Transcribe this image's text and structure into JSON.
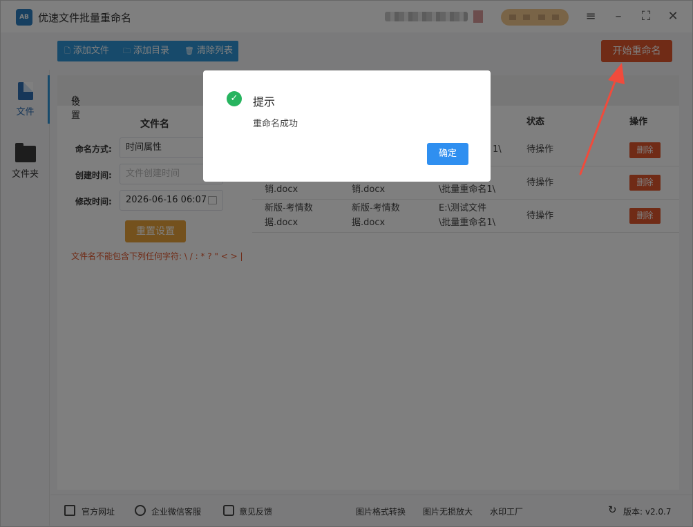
{
  "window": {
    "title": "优速文件批量重命名",
    "logo_text": "AB"
  },
  "toolbar": {
    "add_file": "添加文件",
    "add_dir": "添加目录",
    "clear_list": "清除列表",
    "start": "开始重命名"
  },
  "sidebar": {
    "items": [
      {
        "label": "文件",
        "icon": "file-icon"
      },
      {
        "label": "文件夹",
        "icon": "folder-icon"
      }
    ]
  },
  "settings": {
    "header": "设置",
    "section_title": "文件名",
    "naming_mode_label": "命名方式:",
    "naming_mode_value": "时间属性",
    "created_label": "创建时间:",
    "created_placeholder": "文件创建时间",
    "modified_label": "修改时间:",
    "modified_value": "2026-06-16 06:07",
    "reset_button": "重置设置",
    "warning": "文件名不能包含下列任何字符: \\ / : * ? \" < > |"
  },
  "table": {
    "headers": {
      "status": "状态",
      "action": "操作"
    },
    "rows": [
      {
        "col1": "",
        "col2": "",
        "col3": "1\\",
        "status": "待操作",
        "action": "删除"
      },
      {
        "col1": "销.docx",
        "col2": "销.docx",
        "col3": "\\批量重命名1\\",
        "status": "待操作",
        "action": "删除"
      },
      {
        "col1a": "新版-考情数",
        "col1b": "据.docx",
        "col2a": "新版-考情数",
        "col2b": "据.docx",
        "col3a": "E:\\测试文件",
        "col3b": "\\批量重命名1\\",
        "status": "待操作",
        "action": "删除"
      }
    ]
  },
  "footer": {
    "website": "官方网址",
    "wechat": "企业微信客服",
    "feedback": "意见反馈",
    "img_convert": "图片格式转换",
    "img_enlarge": "图片无损放大",
    "watermark": "水印工厂",
    "version": "版本: v2.0.7"
  },
  "dialog": {
    "title": "提示",
    "message": "重命名成功",
    "confirm": "确定"
  },
  "colors": {
    "accent": "#2f95d6",
    "start_button": "#e0562d",
    "success": "#27b45f",
    "arrow": "#f04b3c"
  }
}
